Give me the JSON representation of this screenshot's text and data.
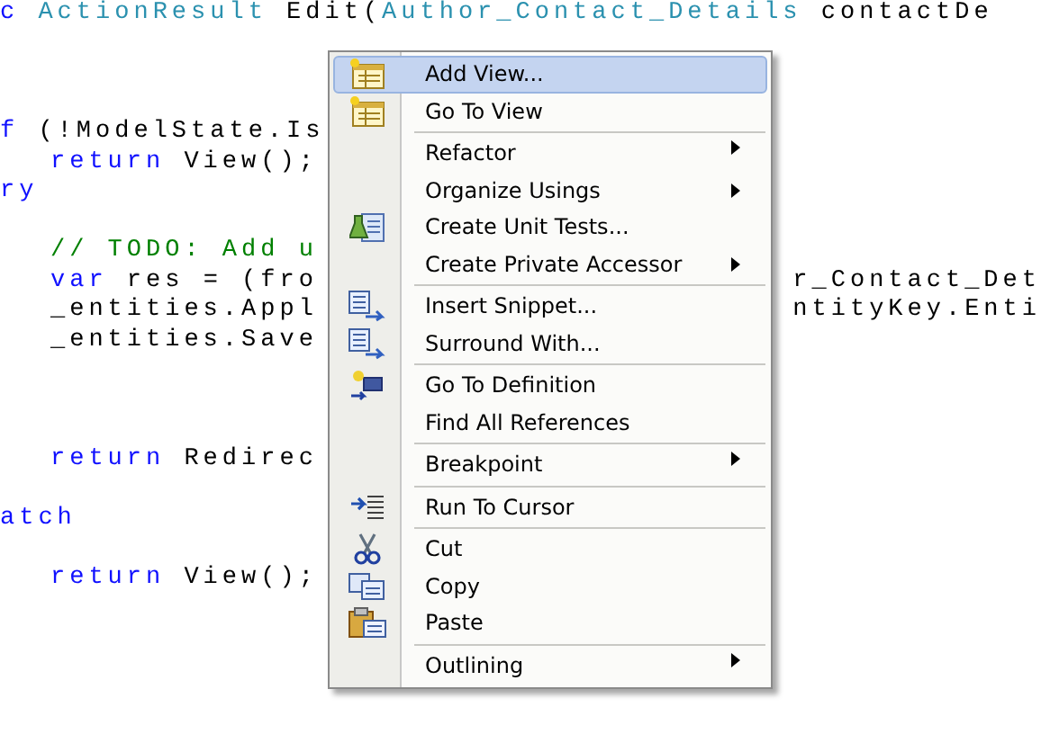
{
  "code_lines": [
    {
      "kind": "code",
      "indented": false,
      "left": [
        {
          "kind": "keyword",
          "text": "c"
        },
        {
          "kind": "type",
          "text": " ActionResult"
        },
        {
          "kind": "plain",
          "text": " Edit("
        },
        {
          "kind": "type",
          "text": "Author_Contact_Details"
        },
        {
          "kind": "plain",
          "text": " contactDe"
        }
      ]
    },
    {
      "kind": "blank"
    },
    {
      "kind": "blank"
    },
    {
      "kind": "blank"
    },
    {
      "kind": "code",
      "indented": false,
      "left": [
        {
          "kind": "keyword",
          "text": "f"
        },
        {
          "kind": "plain",
          "text": " (!ModelState.Is"
        }
      ]
    },
    {
      "kind": "code",
      "indented": true,
      "left": [
        {
          "kind": "keyword",
          "text": "return"
        },
        {
          "kind": "plain",
          "text": " View();"
        }
      ]
    },
    {
      "kind": "code",
      "indented": false,
      "left": [
        {
          "kind": "keyword",
          "text": "ry"
        }
      ]
    },
    {
      "kind": "blank"
    },
    {
      "kind": "code",
      "indented": true,
      "left": [
        {
          "kind": "comment",
          "text": "// TODO: Add u"
        }
      ]
    },
    {
      "kind": "code",
      "indented": true,
      "left": [
        {
          "kind": "keyword",
          "text": "var"
        },
        {
          "kind": "plain",
          "text": " res = (fro"
        }
      ],
      "right": [
        {
          "kind": "plain",
          "text": "r_Contact_Det"
        }
      ]
    },
    {
      "kind": "code",
      "indented": true,
      "left": [
        {
          "kind": "plain",
          "text": "_entities.Appl"
        }
      ],
      "right": [
        {
          "kind": "plain",
          "text": "ntityKey.Enti"
        }
      ]
    },
    {
      "kind": "code",
      "indented": true,
      "left": [
        {
          "kind": "plain",
          "text": "_entities.Save"
        }
      ]
    },
    {
      "kind": "blank"
    },
    {
      "kind": "blank"
    },
    {
      "kind": "blank"
    },
    {
      "kind": "code",
      "indented": true,
      "left": [
        {
          "kind": "keyword",
          "text": "return"
        },
        {
          "kind": "plain",
          "text": " Redirec"
        }
      ]
    },
    {
      "kind": "blank"
    },
    {
      "kind": "code",
      "indented": false,
      "left": [
        {
          "kind": "keyword",
          "text": "atch"
        }
      ]
    },
    {
      "kind": "blank"
    },
    {
      "kind": "code",
      "indented": true,
      "left": [
        {
          "kind": "keyword",
          "text": "return"
        },
        {
          "kind": "plain",
          "text": " View();"
        }
      ]
    }
  ],
  "context_menu": {
    "items": [
      {
        "label": "Add View...",
        "kind": "view",
        "selected": true,
        "submenu": false,
        "separator_before": false
      },
      {
        "label": "Go To View",
        "kind": "view",
        "selected": false,
        "submenu": false,
        "separator_before": false
      },
      {
        "label": "Refactor",
        "kind": "plain",
        "selected": false,
        "submenu": true,
        "separator_before": true
      },
      {
        "label": "Organize Usings",
        "kind": "plain",
        "selected": false,
        "submenu": true,
        "separator_before": false
      },
      {
        "label": "Create Unit Tests...",
        "kind": "unit-test",
        "selected": false,
        "submenu": false,
        "separator_before": false
      },
      {
        "label": "Create Private Accessor",
        "kind": "plain",
        "selected": false,
        "submenu": true,
        "separator_before": false
      },
      {
        "label": "Insert Snippet...",
        "kind": "snippet",
        "selected": false,
        "submenu": false,
        "separator_before": true
      },
      {
        "label": "Surround With...",
        "kind": "snippet",
        "selected": false,
        "submenu": false,
        "separator_before": false
      },
      {
        "label": "Go To Definition",
        "kind": "definition",
        "selected": false,
        "submenu": false,
        "separator_before": true
      },
      {
        "label": "Find All References",
        "kind": "plain",
        "selected": false,
        "submenu": false,
        "separator_before": false
      },
      {
        "label": "Breakpoint",
        "kind": "plain",
        "selected": false,
        "submenu": true,
        "separator_before": true
      },
      {
        "label": "Run To Cursor",
        "kind": "run-to-cursor",
        "selected": false,
        "submenu": false,
        "separator_before": true
      },
      {
        "label": "Cut",
        "kind": "cut",
        "selected": false,
        "submenu": false,
        "separator_before": true
      },
      {
        "label": "Copy",
        "kind": "copy",
        "selected": false,
        "submenu": false,
        "separator_before": false
      },
      {
        "label": "Paste",
        "kind": "paste",
        "selected": false,
        "submenu": false,
        "separator_before": false
      },
      {
        "label": "Outlining",
        "kind": "plain",
        "selected": false,
        "submenu": true,
        "separator_before": true
      }
    ]
  }
}
